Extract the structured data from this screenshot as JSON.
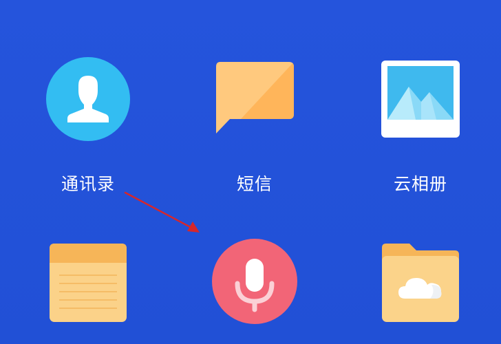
{
  "colors": {
    "background": "#2350d8",
    "contacts_icon": "#33bdf2",
    "messages_icon": "#ffba5c",
    "album_frame": "#ffffff",
    "album_sky": "#39b7ec",
    "notes_icon": "#f9c06a",
    "recorder_icon": "#f26577",
    "files_icon": "#f8c46b",
    "annotation_arrow": "#d6272b",
    "label_text": "#ffffff"
  },
  "apps": {
    "contacts": {
      "label": "通讯录",
      "icon": "person-icon"
    },
    "messages": {
      "label": "短信",
      "icon": "speech-bubble-icon"
    },
    "cloud_album": {
      "label": "云相册",
      "icon": "picture-icon"
    },
    "notes": {
      "icon": "notepad-icon"
    },
    "recorder": {
      "icon": "microphone-icon"
    },
    "files": {
      "icon": "cloud-folder-icon"
    }
  },
  "annotation": {
    "type": "arrow",
    "points_to": "recorder"
  }
}
